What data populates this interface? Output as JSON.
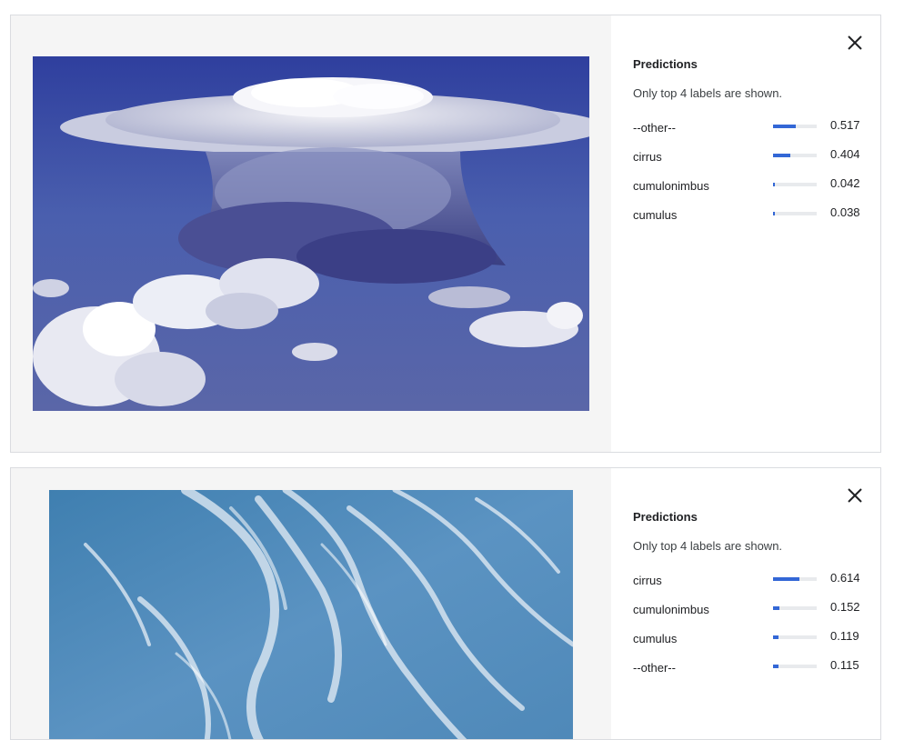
{
  "panels": [
    {
      "image_alt": "cumulonimbus cloud",
      "predictions_title": "Predictions",
      "note": "Only top 4 labels are shown.",
      "predictions": [
        {
          "label": "--other--",
          "score": "0.517",
          "fraction": 0.517
        },
        {
          "label": "cirrus",
          "score": "0.404",
          "fraction": 0.404
        },
        {
          "label": "cumulonimbus",
          "score": "0.042",
          "fraction": 0.042
        },
        {
          "label": "cumulus",
          "score": "0.038",
          "fraction": 0.038
        }
      ]
    },
    {
      "image_alt": "cirrus cloud",
      "predictions_title": "Predictions",
      "note": "Only top 4 labels are shown.",
      "predictions": [
        {
          "label": "cirrus",
          "score": "0.614",
          "fraction": 0.614
        },
        {
          "label": "cumulonimbus",
          "score": "0.152",
          "fraction": 0.152
        },
        {
          "label": "cumulus",
          "score": "0.119",
          "fraction": 0.119
        },
        {
          "label": "--other--",
          "score": "0.115",
          "fraction": 0.115
        }
      ]
    }
  ],
  "colors": {
    "bar_fill": "#3367d6",
    "bar_track": "#e8eaed",
    "image_pane_bg": "#f5f5f5"
  },
  "icons": {
    "close": "close-icon"
  }
}
